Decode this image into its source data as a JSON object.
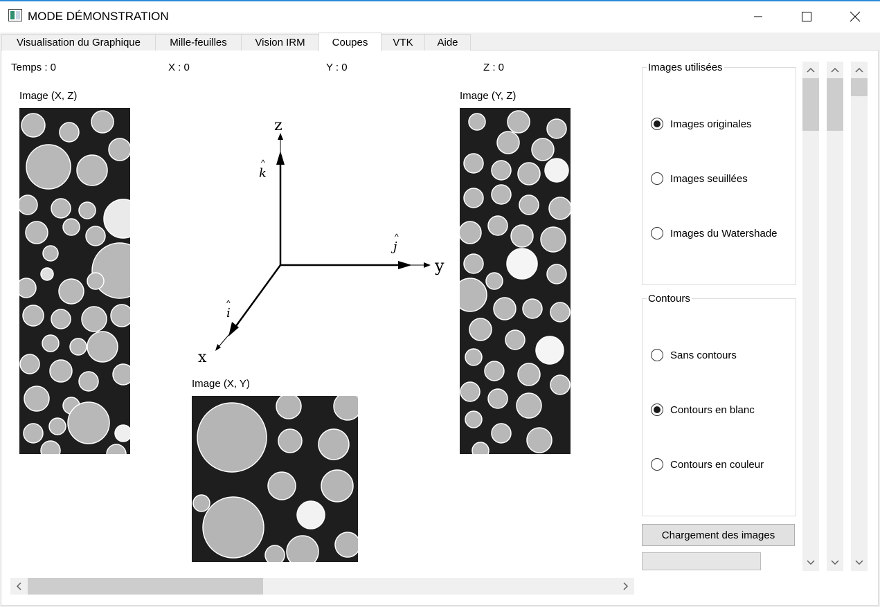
{
  "window": {
    "title": "MODE DÉMONSTRATION"
  },
  "tabs": [
    {
      "label": "Visualisation du Graphique"
    },
    {
      "label": "Mille-feuilles"
    },
    {
      "label": "Vision IRM"
    },
    {
      "label": "Coupes"
    },
    {
      "label": "VTK"
    },
    {
      "label": "Aide"
    }
  ],
  "active_tab": "Coupes",
  "coords": {
    "temps": "Temps : 0",
    "x": "X : 0",
    "y": "Y : 0",
    "z": "Z : 0"
  },
  "images": {
    "xz_label": "Image (X, Z)",
    "yz_label": "Image (Y, Z)",
    "xy_label": "Image (X, Y)"
  },
  "axes": {
    "z": "z",
    "y": "y",
    "x": "x",
    "k": "k",
    "j": "j",
    "i": "i"
  },
  "images_group": {
    "title": "Images utilisées",
    "options": [
      {
        "label": "Images originales",
        "checked": true
      },
      {
        "label": "Images seuillées",
        "checked": false
      },
      {
        "label": "Images du Watershade",
        "checked": false
      }
    ]
  },
  "contours_group": {
    "title": "Contours",
    "options": [
      {
        "label": "Sans contours",
        "checked": false
      },
      {
        "label": "Contours en blanc",
        "checked": true
      },
      {
        "label": "Contours en couleur",
        "checked": false
      }
    ]
  },
  "load_button": "Chargement des images",
  "progress": {
    "value": 0
  },
  "sliders": [
    {
      "position": 0.0
    },
    {
      "position": 0.0
    },
    {
      "position": 0.0
    }
  ],
  "hscroll": {
    "position": 0.0
  },
  "colors": {
    "accent": "#2b8ad8",
    "panel": "#ffffff",
    "chrome": "#f0f0f0",
    "thumb": "#cdcdcd"
  }
}
